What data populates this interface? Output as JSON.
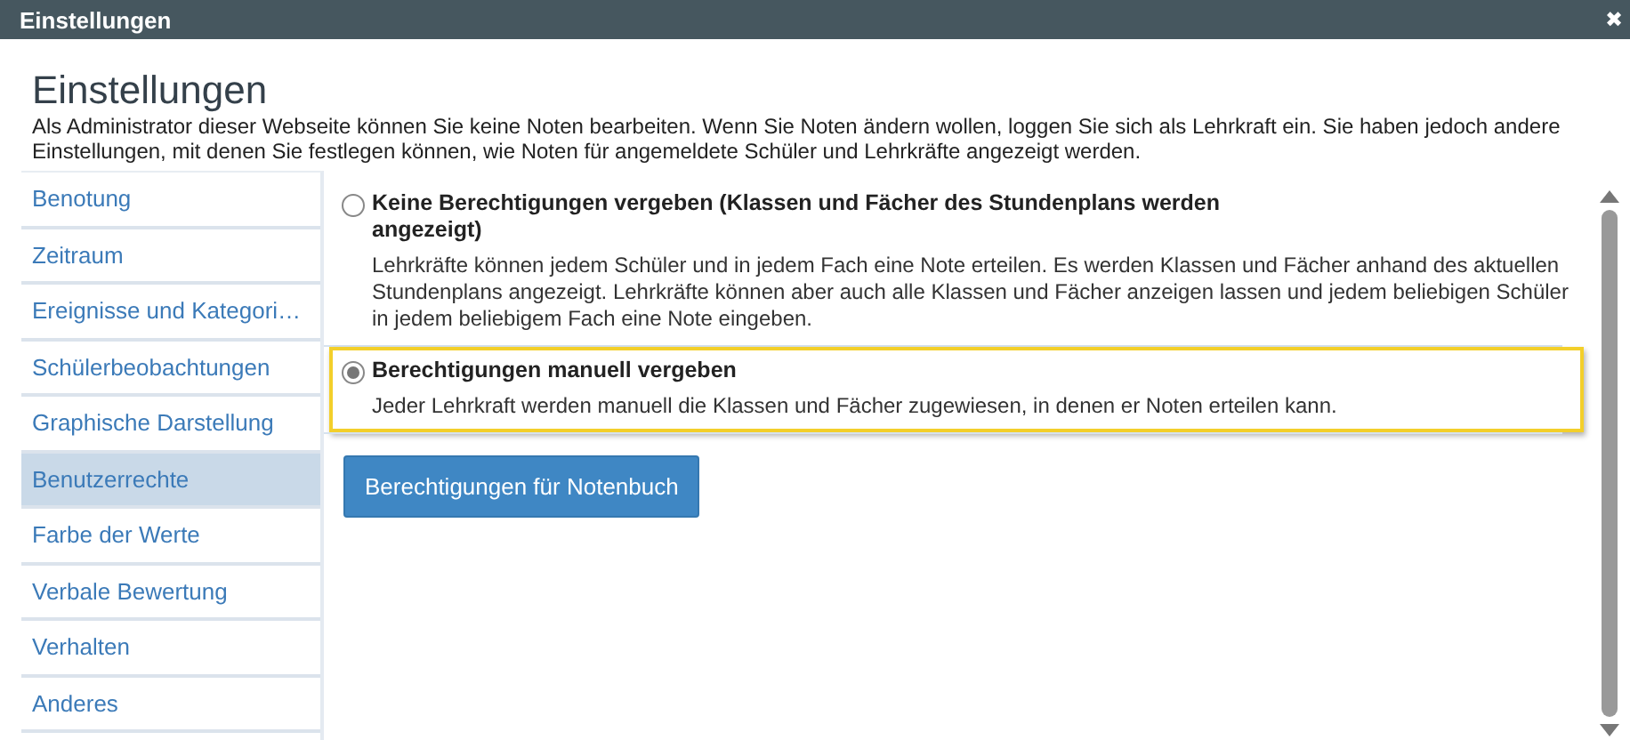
{
  "window": {
    "title": "Einstellungen",
    "close": "✖"
  },
  "header": {
    "title": "Einstellungen",
    "description": "Als Administrator dieser Webseite können Sie keine Noten bearbeiten. Wenn Sie Noten ändern wollen, loggen Sie sich als Lehrkraft ein. Sie haben jedoch andere Einstellungen, mit denen Sie festlegen können, wie Noten für angemeldete Schüler und Lehrkräfte angezeigt werden."
  },
  "sidebar": {
    "items": [
      {
        "label": "Benotung",
        "selected": false
      },
      {
        "label": "Zeitraum",
        "selected": false
      },
      {
        "label": "Ereignisse und Kategori…",
        "selected": false
      },
      {
        "label": "Schülerbeobachtungen",
        "selected": false
      },
      {
        "label": "Graphische Darstellung",
        "selected": false
      },
      {
        "label": "Benutzerrechte",
        "selected": true
      },
      {
        "label": "Farbe der Werte",
        "selected": false
      },
      {
        "label": "Verbale Bewertung",
        "selected": false
      },
      {
        "label": "Verhalten",
        "selected": false
      },
      {
        "label": "Anderes",
        "selected": false
      }
    ]
  },
  "options": [
    {
      "label": "Keine Berechtigungen vergeben (Klassen und Fächer des Stundenplans werden angezeigt)",
      "description": "Lehrkräfte können jedem Schüler und in jedem Fach eine Note erteilen. Es werden Klassen und Fächer anhand des aktuellen Stundenplans angezeigt. Lehrkräfte können aber auch alle Klassen und Fächer anzeigen lassen und jedem beliebigen Schüler in jedem beliebigem Fach eine Note eingeben.",
      "selected": false
    },
    {
      "label": "Berechtigungen manuell vergeben",
      "description": "Jeder Lehrkraft werden manuell die Klassen und Fächer zugewiesen, in denen er Noten erteilen kann.",
      "selected": true
    }
  ],
  "button": "Berechtigungen für Notenbuch"
}
